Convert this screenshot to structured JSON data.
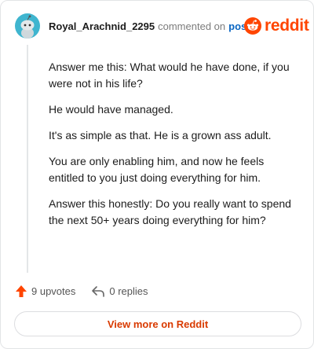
{
  "comment": {
    "author": "Royal_Arachnid_2295",
    "commented_text": "commented on",
    "post_link": "post",
    "paragraphs": [
      "Answer me this: What would he have done, if you were not in his life?",
      "He would have managed.",
      "It's as simple as that. He is a grown ass adult.",
      "You are only enabling him, and now he feels entitled to you just doing everything for him.",
      "Answer this honestly: Do you really want to spend the next 50+ years doing everything for him?"
    ]
  },
  "brand": {
    "name": "reddit",
    "color": "#ff4500"
  },
  "actions": {
    "upvotes": "9 upvotes",
    "replies": "0 replies"
  },
  "view_more_label": "View more on Reddit",
  "colors": {
    "accent": "#ff4500",
    "link": "#0a66c2",
    "avatar": "#3fb5cf"
  },
  "icons": [
    "avatar-icon",
    "reddit-logo-icon",
    "upvote-arrow-icon",
    "reply-arrow-icon"
  ]
}
